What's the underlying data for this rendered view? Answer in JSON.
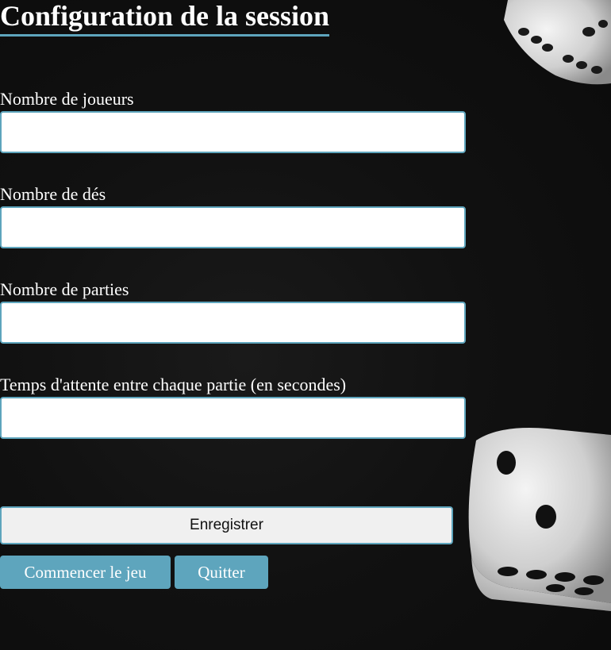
{
  "page": {
    "title": "Configuration de la session"
  },
  "form": {
    "fields": [
      {
        "label": "Nombre de joueurs",
        "value": ""
      },
      {
        "label": "Nombre de dés",
        "value": ""
      },
      {
        "label": "Nombre de parties",
        "value": ""
      },
      {
        "label": "Temps d'attente entre chaque partie (en secondes)",
        "value": ""
      }
    ]
  },
  "buttons": {
    "save_label": "Enregistrer",
    "start_label": "Commencer le jeu",
    "quit_label": "Quitter"
  },
  "colors": {
    "accent": "#5ea5bd",
    "background": "#111111",
    "input_background": "#ffffff",
    "save_button_background": "#f0f0f0"
  },
  "background": {
    "image": "dice-photo"
  }
}
